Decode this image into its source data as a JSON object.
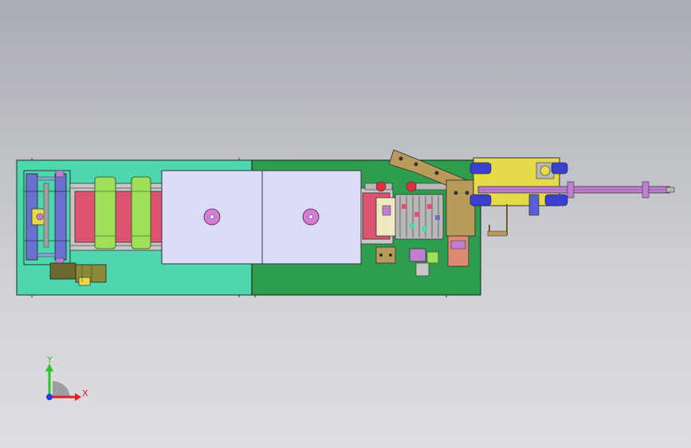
{
  "view": {
    "background_top": "#a9acb2",
    "background_bottom": "#dcdee1"
  },
  "model": {
    "base_left_color": "#4ed6ae",
    "base_right_color": "#2e9e4e",
    "cover_color": "#dcdcf8",
    "belt_color": "#dd5470",
    "roller_color": "#9ee05a",
    "frame_color": "#6a6fd0",
    "bracket_color": "#e4da4a",
    "arm_color": "#b89a5a",
    "rail_color": "#c07ed0"
  },
  "triad": {
    "x_label": "X",
    "y_label": "Y",
    "x_color": "#e0202a",
    "y_color": "#30c030",
    "z_color": "#2040e0"
  }
}
